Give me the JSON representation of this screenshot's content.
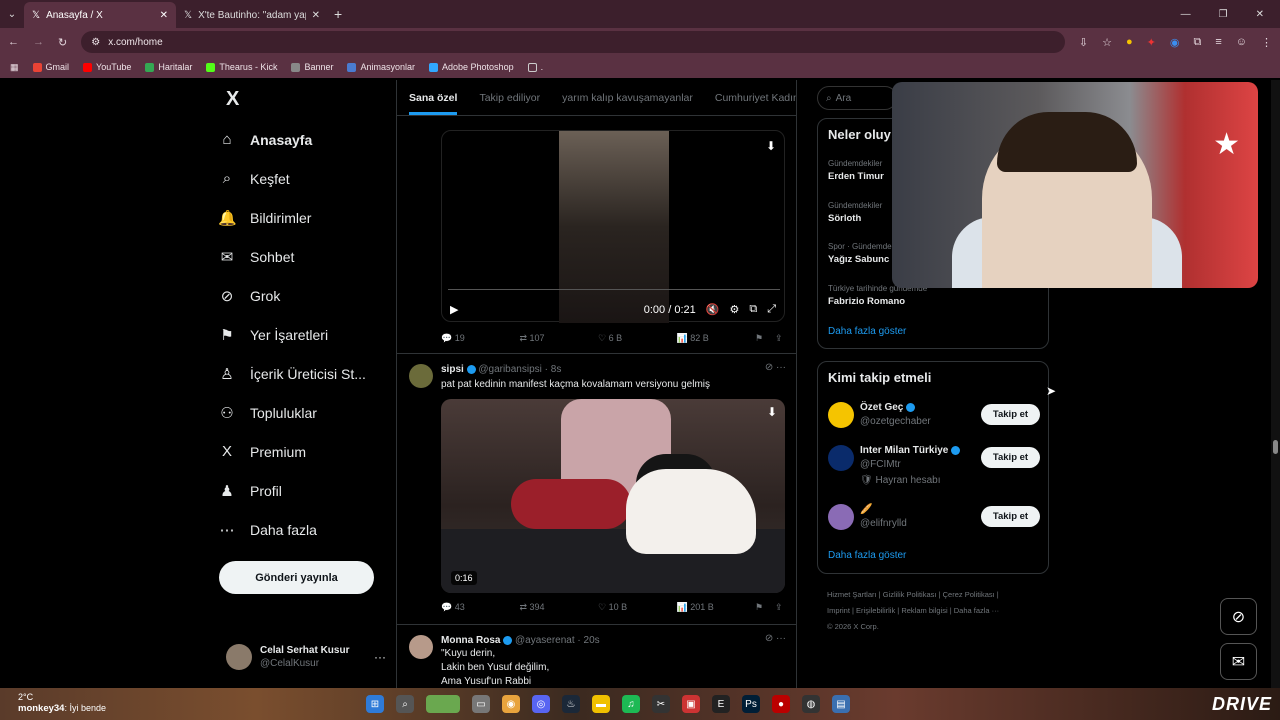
{
  "browser": {
    "tabs": [
      {
        "label": "Anasayfa / X"
      },
      {
        "label": "X'te Bautinho: \"adam yapacağı"
      }
    ],
    "url": "x.com/home",
    "bookmarks": [
      {
        "label": "Gmail",
        "color": "#ea4335"
      },
      {
        "label": "YouTube",
        "color": "#ff0000"
      },
      {
        "label": "Haritalar",
        "color": "#34a853"
      },
      {
        "label": "Thearus - Kick",
        "color": "#53fc18"
      },
      {
        "label": "Banner",
        "color": "#888888"
      },
      {
        "label": "Animasyonlar",
        "color": "#4a7bd0"
      },
      {
        "label": "Adobe Photoshop",
        "color": "#31a8ff"
      },
      {
        "label": ".",
        "color": "#aaaaaa"
      }
    ]
  },
  "nav": {
    "logo": "X",
    "items": [
      {
        "label": "Anasayfa",
        "icon": "⌂"
      },
      {
        "label": "Keşfet",
        "icon": "⌕"
      },
      {
        "label": "Bildirimler",
        "icon": "🔔"
      },
      {
        "label": "Sohbet",
        "icon": "✉"
      },
      {
        "label": "Grok",
        "icon": "⊘"
      },
      {
        "label": "Yer İşaretleri",
        "icon": "⚑"
      },
      {
        "label": "İçerik Üreticisi St...",
        "icon": "♙"
      },
      {
        "label": "Topluluklar",
        "icon": "⚇"
      },
      {
        "label": "Premium",
        "icon": "X"
      },
      {
        "label": "Profil",
        "icon": "♟"
      },
      {
        "label": "Daha fazla",
        "icon": "⋯"
      }
    ],
    "post_button": "Gönderi yayınla",
    "profile": {
      "name": "Celal Serhat Kusur",
      "handle": "@CelalKusur",
      "more": "···"
    }
  },
  "feed": {
    "tabs": [
      "Sana özel",
      "Takip ediliyor",
      "yarım kalıp kavuşamayanlar",
      "Cumhuriyet Kadın"
    ],
    "video1": {
      "time": "0:00 / 0:21"
    },
    "actions1": {
      "reply": "19",
      "retweet": "107",
      "like": "6 B",
      "views": "82 B"
    },
    "tweet2": {
      "name": "sipsi",
      "handle": "@garibansipsi · 8s",
      "text": "pat pat kedinin manifest kaçma kovalamam versiyonu gelmiş",
      "duration": "0:16"
    },
    "actions2": {
      "reply": "43",
      "retweet": "394",
      "like": "10 B",
      "views": "201 B"
    },
    "tweet3": {
      "name": "Monna Rosa",
      "handle": "@ayaserenat · 20s",
      "lines": [
        "\"Kuyu derin,",
        "Lakin ben Yusuf değilim,",
        "Ama Yusuf'un Rabbi"
      ]
    }
  },
  "right": {
    "search_placeholder": "Ara",
    "trends_title": "Neler oluy",
    "trends": [
      {
        "context": "Gündemdekiler",
        "name": "Erden Timur"
      },
      {
        "context": "Gündemdekiler",
        "name": "Sörloth"
      },
      {
        "context": "Spor · Gündemde",
        "name": "Yağız Sabunc"
      },
      {
        "context": "Türkiye tarihinde gündemde",
        "name": "Fabrizio Romano"
      }
    ],
    "show_more": "Daha fazla göster",
    "who_title": "Kimi takip etmeli",
    "who": [
      {
        "name": "Özet Geç",
        "handle": "@ozetgechaber",
        "button": "Takip et",
        "color": "#f5c400",
        "note": ""
      },
      {
        "name": "Inter Milan Türkiye",
        "handle": "@FCIMtr",
        "button": "Takip et",
        "color": "#0a2b6b",
        "note": "Hayran hesabı"
      },
      {
        "name": "🥖",
        "handle": "@elifnrylld",
        "button": "Takip et",
        "color": "#8a6bb5",
        "note": ""
      }
    ],
    "who_show_more": "Daha fazla göster",
    "footer": [
      "Hizmet Şartları",
      "Gizlilik Politikası",
      "Çerez Politikası",
      "Imprint",
      "Erişilebilirlik",
      "Reklam bilgisi",
      "Daha fazla ···",
      "© 2026 X Corp."
    ]
  },
  "taskbar": {
    "temp": "2°C",
    "user": "monkey34",
    "note": "İyi bende",
    "brand": "DRIVE"
  }
}
